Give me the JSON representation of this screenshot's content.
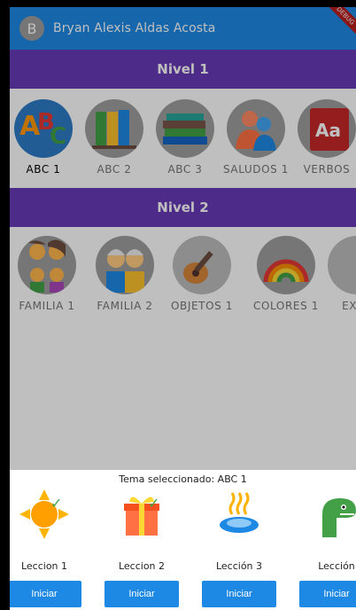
{
  "user": {
    "initial": "B",
    "name": "Bryan Alexis Aldas Acosta"
  },
  "debug_banner": "DEBUG",
  "levels": [
    {
      "title": "Nivel 1",
      "topics": [
        "ABC 1",
        "ABC 2",
        "ABC 3",
        "SALUDOS 1",
        "VERBOS"
      ]
    },
    {
      "title": "Nivel 2",
      "topics": [
        "FAMILIA 1",
        "FAMILIA 2",
        "OBJETOS 1",
        "COLORES 1",
        "EXPR"
      ]
    }
  ],
  "selected_topic": "ABC 1",
  "sheet": {
    "title": "Tema seleccionado: ABC 1",
    "lessons": [
      {
        "name": "Leccion 1",
        "completed": true,
        "icon": "sun-icon"
      },
      {
        "name": "Leccion 2",
        "completed": true,
        "icon": "gift-icon"
      },
      {
        "name": "Lección 3",
        "completed": false,
        "icon": "hot-spring-icon"
      },
      {
        "name": "Lección",
        "completed": false,
        "icon": "dinosaur-icon"
      }
    ],
    "button_label": "Iniciar"
  },
  "colors": {
    "appbar": "#1e88e5",
    "level_header": "#673ab7",
    "button": "#1e88e5",
    "check": "#43a047"
  }
}
